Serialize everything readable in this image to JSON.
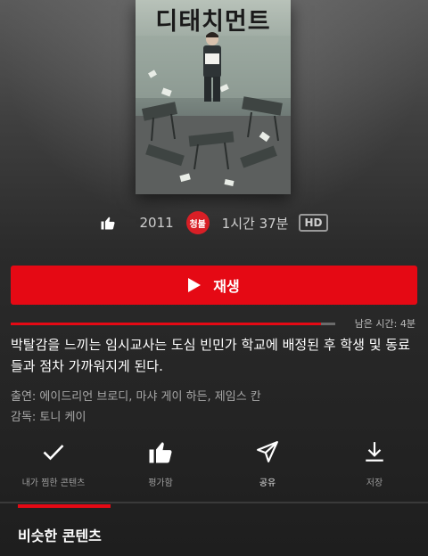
{
  "poster": {
    "title": "디태치먼트"
  },
  "meta": {
    "like_icon": "thumbs-up-icon",
    "year": "2011",
    "rating_badge": "청불",
    "runtime": "1시간 37분",
    "quality_badge": "HD"
  },
  "play_button": {
    "icon": "play-icon",
    "label": "재생"
  },
  "progress": {
    "fraction": 0.955,
    "remaining_label": "남은 시간: 4분",
    "fill_color": "#e50914"
  },
  "synopsis": "박탈감을 느끼는 임시교사는 도심 빈민가 학교에 배정된 후 학생 및 동료들과 점차 가까워지게 된다.",
  "cast": "출연: 에이드리언 브로디, 마샤 게이 하든, 제임스 칸",
  "director": "감독: 토니 케이",
  "actions": [
    {
      "icon": "checkmark-icon",
      "label": "내가 찜한 콘텐츠"
    },
    {
      "icon": "thumbs-up-icon",
      "label": "평가함"
    },
    {
      "icon": "share-icon",
      "label": "공유"
    },
    {
      "icon": "download-icon",
      "label": "저장"
    }
  ],
  "section_tab": {
    "title": "비슷한 콘텐츠"
  },
  "colors": {
    "accent": "#e50914",
    "background": "#262626"
  }
}
